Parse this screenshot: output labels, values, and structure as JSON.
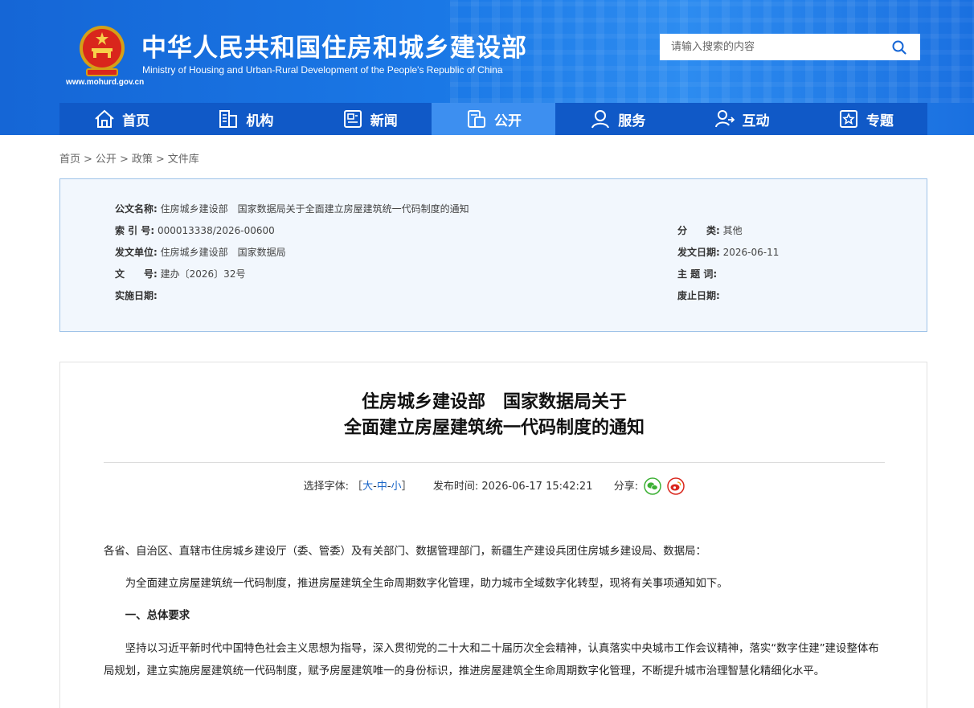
{
  "header": {
    "site_title": "中华人民共和国住房和城乡建设部",
    "site_subtitle": "Ministry of Housing and Urban-Rural Development of the People's Republic of China",
    "site_url": "www.mohurd.gov.cn",
    "search_placeholder": "请输入搜索的内容",
    "brand_color": "#1566d6",
    "nav_active_color": "#3d8ff0"
  },
  "nav": {
    "items": [
      {
        "label": "首页",
        "icon": "home-icon"
      },
      {
        "label": "机构",
        "icon": "building-icon"
      },
      {
        "label": "新闻",
        "icon": "newspaper-icon"
      },
      {
        "label": "公开",
        "icon": "document-icon",
        "active": true
      },
      {
        "label": "服务",
        "icon": "service-person-icon"
      },
      {
        "label": "互动",
        "icon": "interact-person-icon"
      },
      {
        "label": "专题",
        "icon": "star-icon"
      }
    ]
  },
  "breadcrumb": [
    "首页",
    "公开",
    "政策",
    "文件库"
  ],
  "info": {
    "doc_name_label": "公文名称:",
    "doc_name": "住房城乡建设部　国家数据局关于全面建立房屋建筑统一代码制度的通知",
    "index_label": "索 引 号:",
    "index": "000013338/2026-00600",
    "category_label": "分　　类:",
    "category": "其他",
    "issuer_label": "发文单位:",
    "issuer": "住房城乡建设部　国家数据局",
    "issue_date_label": "发文日期:",
    "issue_date": "2026-06-11",
    "doc_no_label": "文　　号:",
    "doc_no": "建办〔2026〕32号",
    "keywords_label": "主 题 词:",
    "keywords": "",
    "effective_label": "实施日期:",
    "effective": "",
    "repeal_label": "废止日期:",
    "repeal": ""
  },
  "article": {
    "title_line1": "住房城乡建设部　国家数据局关于",
    "title_line2": "全面建立房屋建筑统一代码制度的通知",
    "font_select_label": "选择字体:",
    "bracket_open": "［",
    "bracket_close": "］",
    "font_large": "大",
    "font_medium": "中",
    "font_small": "小",
    "dash": "-",
    "publish_label": "发布时间:",
    "publish_time": "2026-06-17 15:42:21",
    "share_label": "分享:",
    "addressee": "各省、自治区、直辖市住房城乡建设厅（委、管委）及有关部门、数据管理部门，新疆生产建设兵团住房城乡建设局、数据局：",
    "para1": "为全面建立房屋建筑统一代码制度，推进房屋建筑全生命周期数字化管理，助力城市全域数字化转型，现将有关事项通知如下。",
    "heading1": "一、总体要求",
    "para2": "坚持以习近平新时代中国特色社会主义思想为指导，深入贯彻党的二十大和二十届历次全会精神，认真落实中央城市工作会议精神，落实“数字住建”建设整体布局规划，建立实施房屋建筑统一代码制度，赋予房屋建筑唯一的身份标识，推进房屋建筑全生命周期数字化管理，不断提升城市治理智慧化精细化水平。"
  }
}
